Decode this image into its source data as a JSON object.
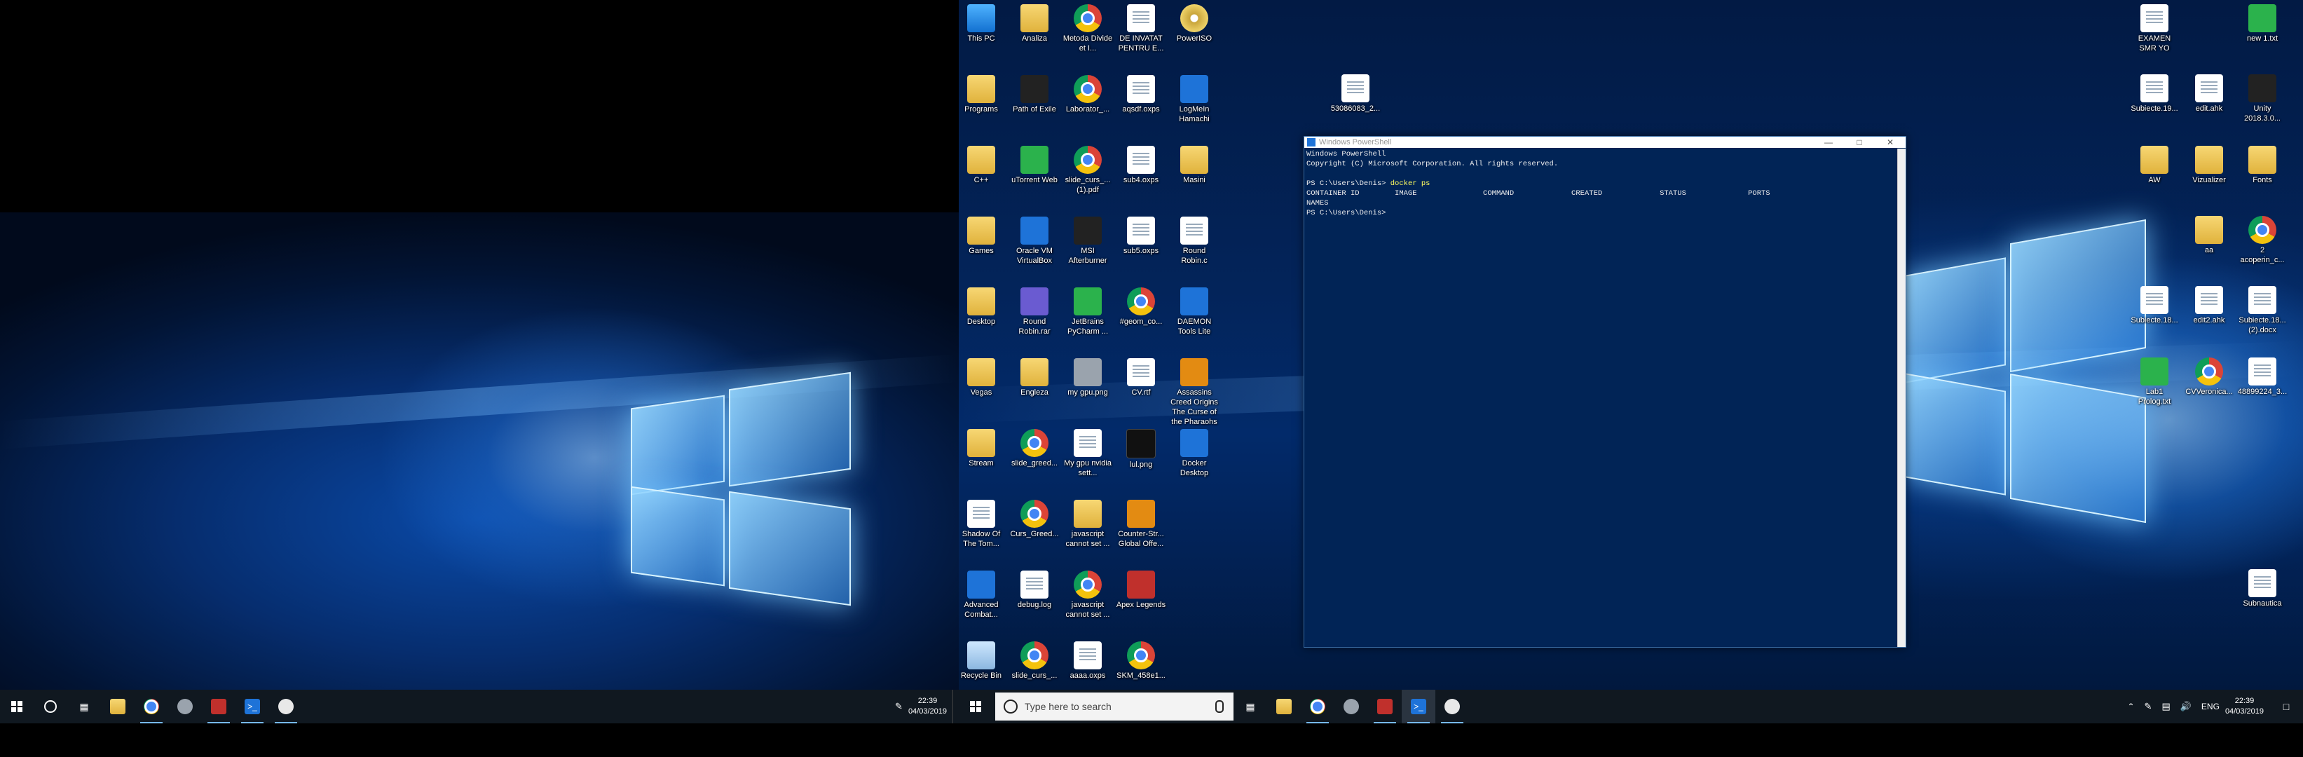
{
  "left_monitor": {
    "taskbar": {
      "clock_time": "22:39",
      "clock_date": "04/03/2019"
    }
  },
  "desktop_icons": [
    {
      "label": "This PC",
      "kind": "pc",
      "name": "this-pc-icon"
    },
    {
      "label": "Analiza",
      "kind": "folder",
      "name": "folder-icon"
    },
    {
      "label": "Metoda Divide et I...",
      "kind": "chrome",
      "name": "chrome-file-icon"
    },
    {
      "label": "DE INVATAT PENTRU E...",
      "kind": "doc",
      "name": "document-icon"
    },
    {
      "label": "PowerISO",
      "kind": "disc",
      "name": "poweriso-icon"
    },
    {
      "label": "Programs",
      "kind": "folder",
      "name": "folder-icon"
    },
    {
      "label": "Path of Exile",
      "kind": "dark",
      "name": "path-of-exile-icon"
    },
    {
      "label": "Laborator_...",
      "kind": "chrome",
      "name": "chrome-file-icon"
    },
    {
      "label": "aqsdf.oxps",
      "kind": "doc",
      "name": "document-icon"
    },
    {
      "label": "LogMeIn Hamachi",
      "kind": "blue",
      "name": "hamachi-icon"
    },
    {
      "label": "C++",
      "kind": "folder",
      "name": "folder-icon"
    },
    {
      "label": "uTorrent Web",
      "kind": "green",
      "name": "utorrent-icon"
    },
    {
      "label": "slide_curs_... (1).pdf",
      "kind": "chrome",
      "name": "chrome-file-icon"
    },
    {
      "label": "sub4.oxps",
      "kind": "doc",
      "name": "document-icon"
    },
    {
      "label": "Masini",
      "kind": "folder",
      "name": "folder-icon"
    },
    {
      "label": "Games",
      "kind": "folder",
      "name": "folder-icon"
    },
    {
      "label": "Oracle VM VirtualBox",
      "kind": "blue",
      "name": "virtualbox-icon"
    },
    {
      "label": "MSI Afterburner",
      "kind": "dark",
      "name": "msi-afterburner-icon"
    },
    {
      "label": "sub5.oxps",
      "kind": "doc",
      "name": "document-icon"
    },
    {
      "label": "Round Robin.c",
      "kind": "doc",
      "name": "c-source-icon"
    },
    {
      "label": "Desktop",
      "kind": "folder",
      "name": "folder-icon"
    },
    {
      "label": "Round Robin.rar",
      "kind": "purple",
      "name": "rar-archive-icon"
    },
    {
      "label": "JetBrains PyCharm ...",
      "kind": "green",
      "name": "pycharm-icon"
    },
    {
      "label": "#geom_co...",
      "kind": "chrome",
      "name": "chrome-file-icon"
    },
    {
      "label": "DAEMON Tools Lite",
      "kind": "blue",
      "name": "daemon-tools-icon"
    },
    {
      "label": "Vegas",
      "kind": "folder",
      "name": "folder-icon"
    },
    {
      "label": "Engleza",
      "kind": "folder",
      "name": "folder-icon"
    },
    {
      "label": "my gpu.png",
      "kind": "gray",
      "name": "image-file-icon"
    },
    {
      "label": "CV.rtf",
      "kind": "doc",
      "name": "document-icon"
    },
    {
      "label": "Assassins Creed Origins The Curse of the Pharaohs",
      "kind": "orange",
      "name": "game-icon"
    },
    {
      "label": "Stream",
      "kind": "folder",
      "name": "folder-icon"
    },
    {
      "label": "slide_greed...",
      "kind": "chrome",
      "name": "chrome-file-icon"
    },
    {
      "label": "My gpu nvidia sett...",
      "kind": "doc",
      "name": "document-icon"
    },
    {
      "label": "lul.png",
      "kind": "black",
      "name": "image-file-icon"
    },
    {
      "label": "Docker Desktop",
      "kind": "blue",
      "name": "docker-icon"
    },
    {
      "label": "Shadow Of The Tom...",
      "kind": "doc",
      "name": "document-icon"
    },
    {
      "label": "Curs_Greed...",
      "kind": "chrome",
      "name": "chrome-file-icon"
    },
    {
      "label": "javascript cannot set ...",
      "kind": "folder",
      "name": "folder-icon"
    },
    {
      "label": "Counter-Str... Global Offe...",
      "kind": "orange",
      "name": "csgo-icon"
    },
    {
      "label": "Advanced Combat...",
      "kind": "blue",
      "name": "advanced-combat-icon"
    },
    {
      "label": "debug.log",
      "kind": "doc",
      "name": "document-icon"
    },
    {
      "label": "javascript cannot set ...",
      "kind": "chrome",
      "name": "chrome-file-icon"
    },
    {
      "label": "Apex Legends",
      "kind": "red",
      "name": "apex-legends-icon"
    },
    {
      "label": "Recycle Bin",
      "kind": "bin",
      "name": "recycle-bin-icon"
    },
    {
      "label": "slide_curs_...",
      "kind": "chrome",
      "name": "chrome-file-icon"
    },
    {
      "label": "aaaa.oxps",
      "kind": "doc",
      "name": "document-icon"
    },
    {
      "label": "SKM_458e1...",
      "kind": "chrome",
      "name": "chrome-file-icon"
    },
    {
      "label": "53086083_2...",
      "kind": "doc",
      "name": "document-icon"
    },
    {
      "label": "EXAMEN SMR YO",
      "kind": "doc",
      "name": "document-icon"
    },
    {
      "label": "new 1.txt",
      "kind": "green",
      "name": "text-file-icon"
    },
    {
      "label": "Subiecte.19...",
      "kind": "doc",
      "name": "document-icon"
    },
    {
      "label": "edit.ahk",
      "kind": "doc",
      "name": "autohotkey-file-icon"
    },
    {
      "label": "Unity 2018.3.0...",
      "kind": "dark",
      "name": "unity-icon"
    },
    {
      "label": "AW",
      "kind": "folder",
      "name": "folder-icon"
    },
    {
      "label": "Vizualizer",
      "kind": "folder",
      "name": "folder-icon"
    },
    {
      "label": "Fonts",
      "kind": "folder",
      "name": "folder-icon"
    },
    {
      "label": "aa",
      "kind": "folder",
      "name": "folder-icon"
    },
    {
      "label": "2 acoperin_c...",
      "kind": "chrome",
      "name": "chrome-file-icon"
    },
    {
      "label": "Subiecte.18...",
      "kind": "doc",
      "name": "document-icon"
    },
    {
      "label": "edit2.ahk",
      "kind": "doc",
      "name": "autohotkey-file-icon"
    },
    {
      "label": "Subiecte.18... (2).docx",
      "kind": "doc",
      "name": "document-icon"
    },
    {
      "label": "Lab1 Prolog.txt",
      "kind": "green",
      "name": "text-file-icon"
    },
    {
      "label": "CVVeronica...",
      "kind": "chrome",
      "name": "chrome-file-icon"
    },
    {
      "label": "48899224_3...",
      "kind": "doc",
      "name": "document-icon"
    },
    {
      "label": "Subnautica",
      "kind": "doc",
      "name": "document-icon"
    }
  ],
  "powershell": {
    "title": "Windows PowerShell",
    "lines": [
      {
        "text": "Windows PowerShell"
      },
      {
        "text": "Copyright (C) Microsoft Corporation. All rights reserved."
      },
      {
        "text": ""
      },
      {
        "prompt": "PS C:\\Users\\Denis> ",
        "cmd": "docker ps"
      },
      {
        "text": "CONTAINER ID        IMAGE               COMMAND             CREATED             STATUS              PORTS"
      },
      {
        "text": "NAMES"
      },
      {
        "prompt": "PS C:\\Users\\Denis> ",
        "cmd": ""
      }
    ],
    "minimize_glyph": "—",
    "maximize_glyph": "□",
    "close_glyph": "✕"
  },
  "right_monitor": {
    "taskbar": {
      "search_placeholder": "Type here to search",
      "language": "ENG",
      "clock_time": "22:39",
      "clock_date": "04/03/2019"
    }
  },
  "colors": {
    "powershell_bg": "#012456",
    "taskbar_bg": "#101820",
    "accent": "#76b9ed"
  }
}
